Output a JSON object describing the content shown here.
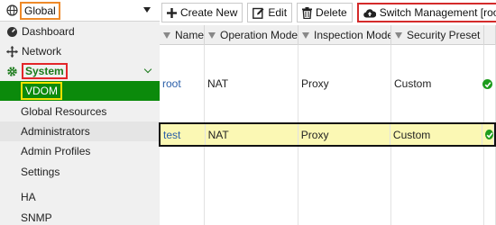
{
  "vdom_selector": {
    "value": "Global"
  },
  "nav": {
    "dashboard": "Dashboard",
    "network": "Network",
    "system": "System",
    "system_items": [
      "VDOM",
      "Global Resources",
      "Administrators",
      "Admin Profiles",
      "Settings"
    ],
    "other_items": [
      "HA",
      "SNMP"
    ]
  },
  "toolbar": {
    "create_new": "Create New",
    "edit": "Edit",
    "delete": "Delete",
    "switch_management": "Switch Management [root]"
  },
  "table": {
    "columns": [
      "Name",
      "Operation Mode",
      "Inspection Mode",
      "Security Preset"
    ],
    "rows": [
      {
        "name": "root",
        "operation_mode": "NAT",
        "inspection_mode": "Proxy",
        "security_preset": "Custom",
        "status": ""
      },
      {
        "name": "test",
        "operation_mode": "NAT",
        "inspection_mode": "Proxy",
        "security_preset": "Custom",
        "status": "enabled"
      }
    ]
  },
  "colors": {
    "accent_green": "#0b8a0b",
    "highlight_row": "#fbf8b4",
    "annotation_red": "#d42a2a",
    "annotation_orange": "#ee8a2a",
    "annotation_yellow": "#f2e000"
  }
}
